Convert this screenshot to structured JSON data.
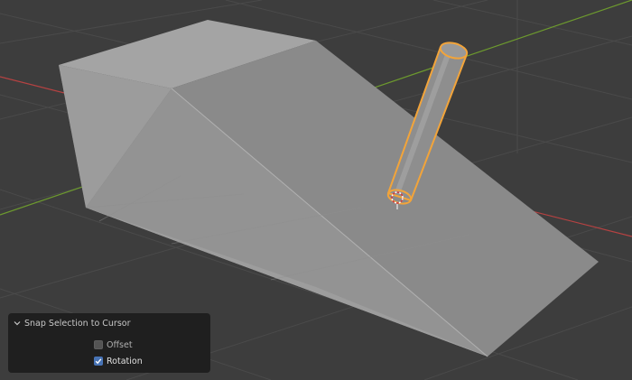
{
  "viewport": {
    "background": "#3d3d3d",
    "grid_line_color": "#4a4a4a",
    "x_axis_color": "#b64242",
    "y_axis_color": "#6d9a2e",
    "selection_outline_color": "#f2a43a"
  },
  "redo_panel": {
    "title": "Snap Selection to Cursor",
    "collapsed": false,
    "options": [
      {
        "label": "Offset",
        "checked": false
      },
      {
        "label": "Rotation",
        "checked": true
      }
    ]
  }
}
